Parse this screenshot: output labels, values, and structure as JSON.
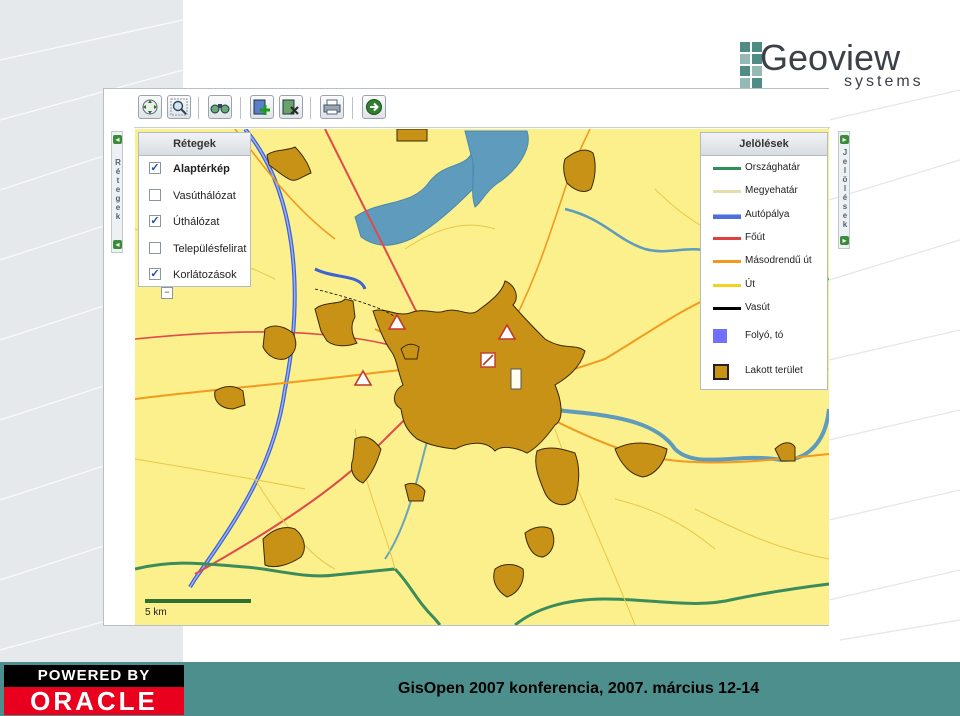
{
  "slide": {
    "logo": {
      "main": "Geoview",
      "sub": "systems"
    },
    "footer": {
      "powered_top": "POWERED BY",
      "powered_bottom": "ORACLE",
      "conference": "GisOpen 2007 konferencia, 2007. március 12-14"
    }
  },
  "app": {
    "toolbar": [
      {
        "name": "pan",
        "icon": "pan-icon"
      },
      {
        "name": "zoom",
        "icon": "zoom-magnifier-icon"
      },
      {
        "name": "binoculars",
        "icon": "binoculars-icon"
      },
      {
        "name": "add",
        "icon": "add-marker-icon"
      },
      {
        "name": "delete",
        "icon": "delete-marker-icon"
      },
      {
        "name": "print",
        "icon": "printer-icon"
      },
      {
        "name": "go",
        "icon": "arrow-right-icon"
      }
    ],
    "left_tab": {
      "letters": [
        "R",
        "é",
        "t",
        "e",
        "g",
        "e",
        "k"
      ]
    },
    "right_tab": {
      "letters": [
        "J",
        "e",
        "l",
        "ö",
        "l",
        "é",
        "s",
        "e",
        "k"
      ]
    },
    "layers": {
      "title": "Rétegek",
      "items": [
        {
          "label": "Alaptérkép",
          "checked": true,
          "bold": true
        },
        {
          "label": "Vasúthálózat",
          "checked": false,
          "bold": false
        },
        {
          "label": "Úthálózat",
          "checked": true,
          "bold": false
        },
        {
          "label": "Településfelirat",
          "checked": false,
          "bold": false
        },
        {
          "label": "Korlátozások",
          "checked": true,
          "bold": false
        }
      ],
      "collapse": "−"
    },
    "legend": {
      "title": "Jelölések",
      "items": [
        {
          "label": "Országhatár",
          "color": "#2f8f55",
          "kind": "line"
        },
        {
          "label": "Megyehatár",
          "color": "#e3ddb0",
          "kind": "line"
        },
        {
          "label": "Autópálya",
          "color": "#4c6fe0",
          "kind": "double"
        },
        {
          "label": "Főút",
          "color": "#e04040",
          "kind": "line"
        },
        {
          "label": "Másodrendű út",
          "color": "#f29a1e",
          "kind": "line"
        },
        {
          "label": "Út",
          "color": "#f2d21e",
          "kind": "line"
        },
        {
          "label": "Vasút",
          "color": "#000000",
          "kind": "line"
        },
        {
          "label": "Folyó, tó",
          "color": "#7070ff",
          "kind": "box"
        },
        {
          "label": "Lakott terület",
          "color": "#c89216",
          "kind": "boxborder"
        }
      ]
    },
    "map": {
      "scale_label": "5 km",
      "colors": {
        "land": "#fbf08c",
        "urban": "#c89216",
        "water": "#5e9bbd",
        "motorway": "#3e62d6",
        "main_road": "#e04a4a",
        "secondary_road": "#f29a1e",
        "minor_road": "#e8c84a",
        "border": "#3a8c5a"
      }
    }
  }
}
